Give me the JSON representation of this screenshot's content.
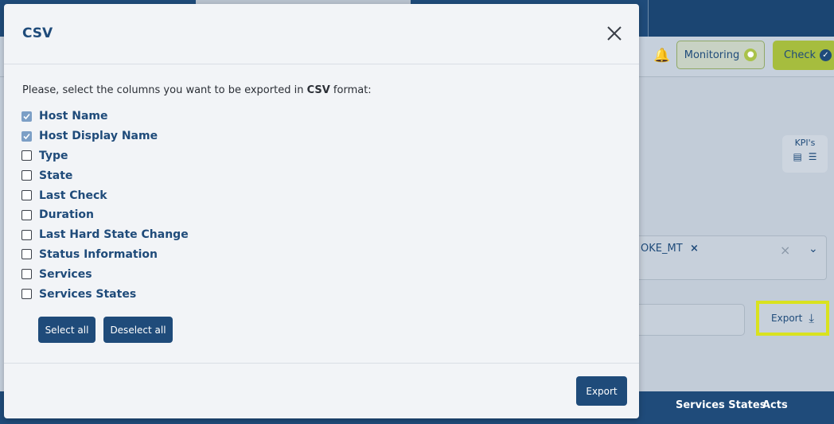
{
  "background": {
    "monitoring_label": "Monitoring",
    "check_label": "Check",
    "kpis_label": "KPI's",
    "filter_tag": "OKE_MT",
    "export_label": "Export",
    "table_columns": [
      "Services States",
      "Acts"
    ]
  },
  "modal": {
    "title": "CSV",
    "intro_prefix": "Please, select the columns you want to be exported in ",
    "intro_format": "CSV",
    "intro_suffix": " format:",
    "columns": [
      {
        "label": "Host Name",
        "checked": true
      },
      {
        "label": "Host Display Name",
        "checked": true
      },
      {
        "label": "Type",
        "checked": false
      },
      {
        "label": "State",
        "checked": false
      },
      {
        "label": "Last Check",
        "checked": false
      },
      {
        "label": "Duration",
        "checked": false
      },
      {
        "label": "Last Hard State Change",
        "checked": false
      },
      {
        "label": "Status Information",
        "checked": false
      },
      {
        "label": "Services",
        "checked": false
      },
      {
        "label": "Services States",
        "checked": false
      }
    ],
    "select_all_label": "Select all",
    "deselect_all_label": "Deselect all",
    "export_label": "Export"
  },
  "colors": {
    "primary": "#1f4b7a",
    "accent_highlight": "#d9e21f",
    "check_green": "#a6bd3e"
  }
}
